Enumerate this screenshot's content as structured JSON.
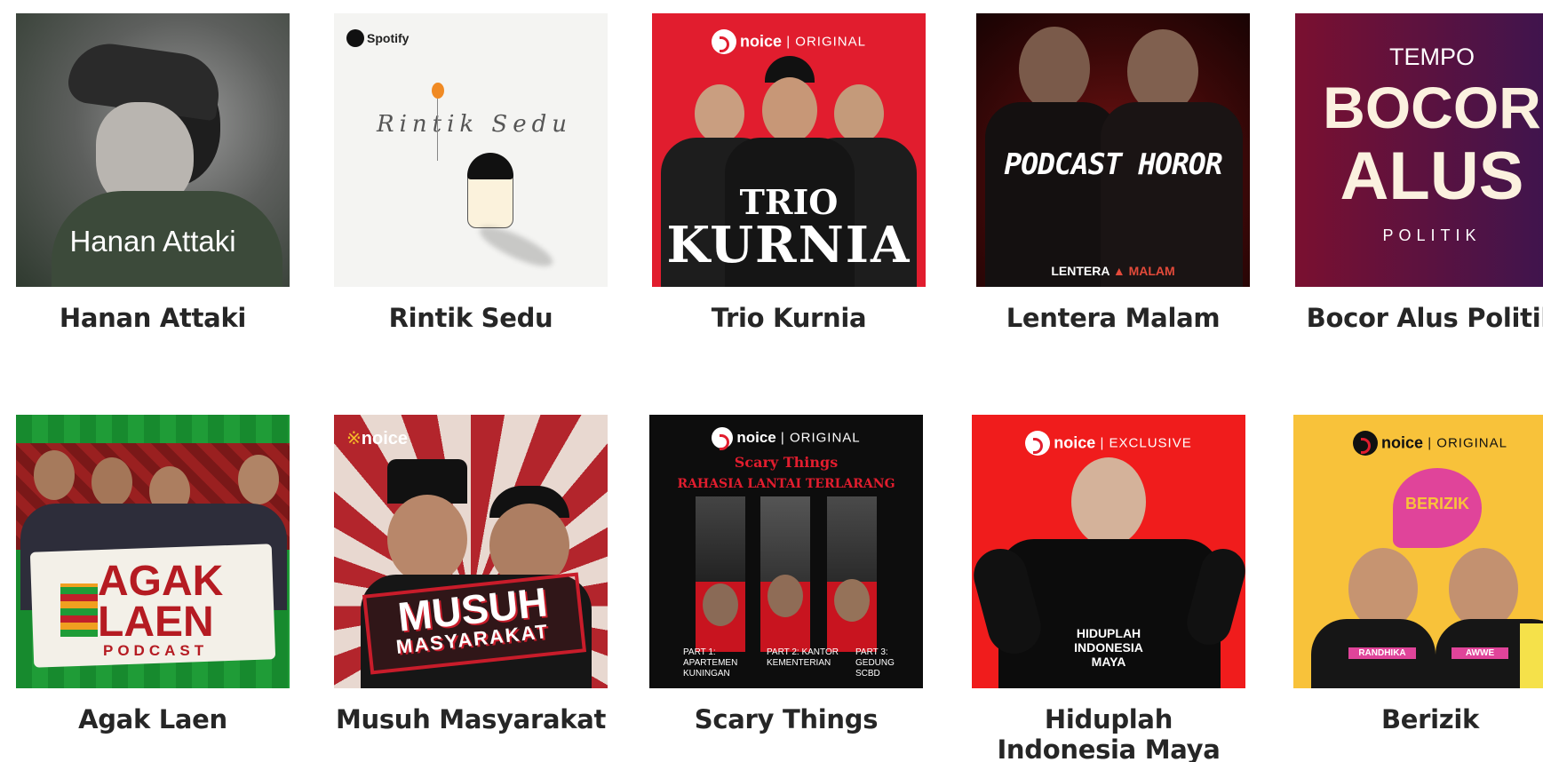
{
  "podcasts": [
    {
      "title": "Hanan Attaki",
      "cover_text": "Hanan Attaki"
    },
    {
      "title": "Rintik Sedu",
      "cover_brand": "Spotify",
      "cover_text": "Rintik Sedu"
    },
    {
      "title": "Trio Kurnia",
      "cover_badge": "noice",
      "cover_badge_sub": "ORIGINAL",
      "cover_text_1": "TRIO",
      "cover_text_2": "KURNIA"
    },
    {
      "title": "Lentera Malam",
      "cover_text": "PODCAST HOROR",
      "cover_footer_1": "LENTERA",
      "cover_footer_2": "MALAM"
    },
    {
      "title": "Bocor Alus Politik",
      "cover_top": "TEMPO",
      "cover_text_1": "BOCOR",
      "cover_text_2": "ALUS",
      "cover_text_3": "POLITIK"
    },
    {
      "title": "Agak Laen",
      "cover_text_1": "AGAK",
      "cover_text_2": "LAEN",
      "cover_text_3": "PODCAST"
    },
    {
      "title": "Musuh Masyarakat",
      "cover_badge": "noice",
      "cover_text_1": "MUSUH",
      "cover_text_2": "MASYARAKAT"
    },
    {
      "title": "Scary Things",
      "cover_badge": "noice",
      "cover_badge_sub": "ORIGINAL",
      "cover_text_1": "Scary Things",
      "cover_text_2": "RAHASIA LANTAI TERLARANG",
      "parts": [
        "PART 1: APARTEMEN KUNINGAN",
        "PART 2: KANTOR KEMENTERIAN",
        "PART 3: GEDUNG SCBD"
      ]
    },
    {
      "title": "Hiduplah Indonesia Maya",
      "cover_badge": "noice",
      "cover_badge_sub": "EXCLUSIVE",
      "cover_text": "HIDUPLAH INDONESIA MAYA"
    },
    {
      "title": "Berizik",
      "cover_badge": "noice",
      "cover_badge_sub": "ORIGINAL",
      "cover_text": "BERIZIK",
      "name_tag_1": "RANDHIKA",
      "name_tag_2": "AWWE"
    }
  ],
  "colors": {
    "title_text": "#262626",
    "noice_red": "#e11d2e"
  }
}
